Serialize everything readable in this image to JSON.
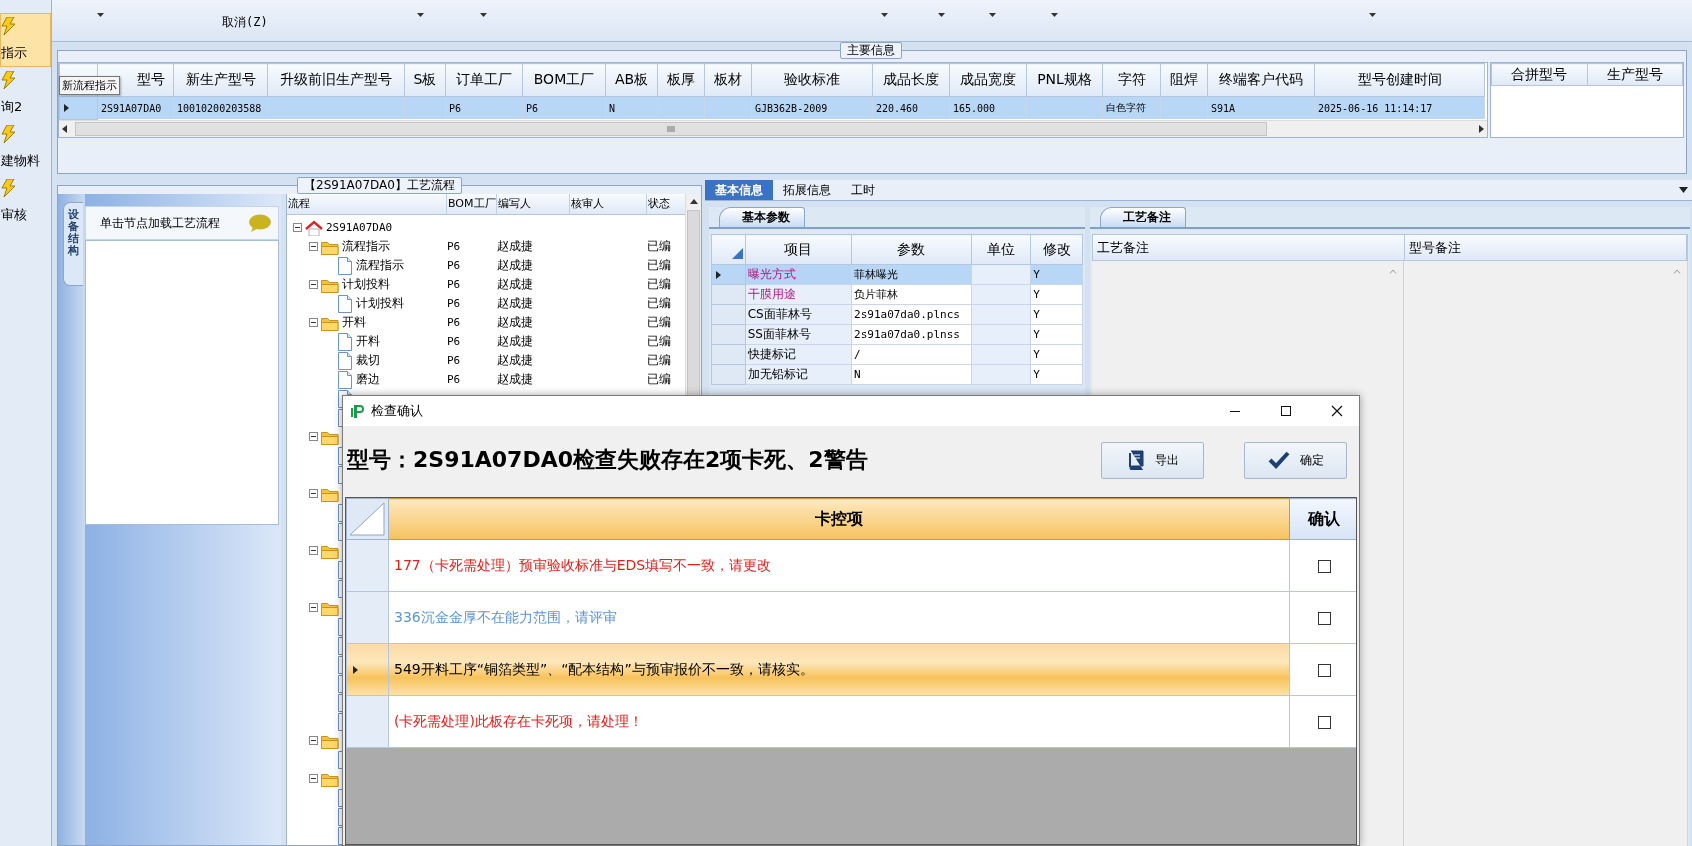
{
  "sidebar": {
    "items": [
      {
        "label": "指示",
        "selected": true
      },
      {
        "label": "询2",
        "selected": false
      },
      {
        "label": "建物料",
        "selected": false
      },
      {
        "label": "审核",
        "selected": false
      }
    ]
  },
  "toolbar": {
    "items": [
      "取消(Z)"
    ]
  },
  "main_info": {
    "title": "主要信息",
    "tooltip": "新流程指示",
    "columns": [
      "型号",
      "新生产型号",
      "升级前旧生产型号",
      "S板",
      "订单工厂",
      "BOM工厂",
      "AB板",
      "板厚",
      "板材",
      "验收标准",
      "成品长度",
      "成品宽度",
      "PNL规格",
      "字符",
      "阻焊",
      "终端客户代码",
      "型号创建时间"
    ],
    "rows": [
      {
        "selected": true,
        "cells": [
          "2S91A07DA0",
          "10010200203588",
          null,
          null,
          "P6",
          "P6",
          "N",
          null,
          null,
          "GJB362B-2009",
          "220.460",
          "165.000",
          null,
          "白色字符",
          null,
          "S91A",
          "2025-06-16 11:14:17"
        ]
      }
    ],
    "side_columns": [
      "合拼型号",
      "生产型号"
    ]
  },
  "flow": {
    "title": "【2S91A07DA0】工艺流程",
    "side_tab": "设备结构",
    "hint": "单击节点加载工艺流程",
    "columns": [
      "流程",
      "BOM工厂",
      "编写人",
      "核审人",
      "状态"
    ],
    "tree": {
      "kind": "root",
      "label": "2S91A07DA0",
      "expanded": true,
      "children": [
        {
          "kind": "folder",
          "label": "流程指示",
          "bom": "P6",
          "writer": "赵成捷",
          "status": "已编",
          "expanded": true,
          "children": [
            {
              "kind": "file",
              "label": "流程指示",
              "bom": "P6",
              "writer": "赵成捷",
              "status": "已编"
            }
          ]
        },
        {
          "kind": "folder",
          "label": "计划投料",
          "bom": "P6",
          "writer": "赵成捷",
          "status": "已编",
          "expanded": true,
          "children": [
            {
              "kind": "file",
              "label": "计划投料",
              "bom": "P6",
              "writer": "赵成捷",
              "status": "已编"
            }
          ]
        },
        {
          "kind": "folder",
          "label": "开料",
          "bom": "P6",
          "writer": "赵成捷",
          "status": "已编",
          "expanded": true,
          "children": [
            {
              "kind": "file",
              "label": "开料",
              "bom": "P6",
              "writer": "赵成捷",
              "status": "已编"
            },
            {
              "kind": "file",
              "label": "裁切",
              "bom": "P6",
              "writer": "赵成捷",
              "status": "已编"
            },
            {
              "kind": "file",
              "label": "磨边",
              "bom": "P6",
              "writer": "赵成捷",
              "status": "已编"
            },
            {
              "kind": "file"
            },
            {
              "kind": "file"
            }
          ]
        },
        {
          "kind": "folder",
          "expanded": true,
          "children": [
            {
              "kind": "file"
            },
            {
              "kind": "file"
            }
          ]
        },
        {
          "kind": "folder",
          "expanded": true,
          "children": [
            {
              "kind": "file"
            },
            {
              "kind": "file"
            }
          ]
        },
        {
          "kind": "folder",
          "expanded": true,
          "children": [
            {
              "kind": "file"
            },
            {
              "kind": "file"
            }
          ]
        },
        {
          "kind": "folder",
          "expanded": true,
          "children": [
            {
              "kind": "file"
            },
            {
              "kind": "file"
            },
            {
              "kind": "file"
            },
            {
              "kind": "file"
            },
            {
              "kind": "file"
            },
            {
              "kind": "file"
            }
          ]
        },
        {
          "kind": "folder",
          "expanded": true,
          "children": [
            {
              "kind": "file"
            }
          ]
        },
        {
          "kind": "folder",
          "expanded": true,
          "children": [
            {
              "kind": "file"
            },
            {
              "kind": "file"
            },
            {
              "kind": "file"
            }
          ]
        }
      ]
    }
  },
  "details": {
    "tabs": [
      {
        "label": "基本信息",
        "selected": true
      },
      {
        "label": "拓展信息",
        "selected": false
      },
      {
        "label": "工时",
        "selected": false
      }
    ],
    "params": {
      "tab": "基本参数",
      "columns": [
        "项目",
        "参数",
        "单位",
        "修改"
      ],
      "rows": [
        {
          "item": "曝光方式",
          "value": "菲林曝光",
          "modified": "Y",
          "selected": true,
          "highlighted": true
        },
        {
          "item": "干膜用途",
          "value": "负片菲林",
          "modified": "Y",
          "selected": false,
          "highlighted": true
        },
        {
          "item": "CS面菲林号",
          "value": "2s91a07da0.plncs",
          "modified": "Y",
          "selected": false,
          "highlighted": false
        },
        {
          "item": "SS面菲林号",
          "value": "2s91a07da0.plnss",
          "modified": "Y",
          "selected": false,
          "highlighted": false
        },
        {
          "item": "快捷标记",
          "value": "/",
          "modified": "Y",
          "selected": false,
          "highlighted": false
        },
        {
          "item": "加无铅标记",
          "value": "N",
          "modified": "Y",
          "selected": false,
          "highlighted": false
        }
      ]
    },
    "notes": {
      "tab": "工艺备注",
      "columns": [
        "工艺备注",
        "型号备注"
      ]
    }
  },
  "dialog": {
    "title": "检查确认",
    "heading": "型号：2S91A07DA0检查失败存在2项卡死、2警告",
    "buttons": [
      {
        "label": "导出",
        "kind": "export"
      },
      {
        "label": "确定",
        "kind": "confirm"
      }
    ],
    "columns": [
      "卡控项",
      "确认"
    ],
    "rows": [
      {
        "text": "177（卡死需处理）预审验收标准与EDS填写不一致，请更改",
        "color": "#e0201c",
        "selected": false,
        "checked": false
      },
      {
        "text": "336沉金金厚不在能力范围，请评审",
        "color": "#5b95d6",
        "selected": false,
        "checked": false
      },
      {
        "text": "549开料工序“铜箔类型”、“配本结构”与预审报价不一致，请核实。",
        "color": "#000000",
        "selected": true,
        "checked": false
      },
      {
        "text": "(卡死需处理)此板存在卡死项，请处理！",
        "color": "#e0201c",
        "selected": false,
        "checked": false
      }
    ]
  }
}
